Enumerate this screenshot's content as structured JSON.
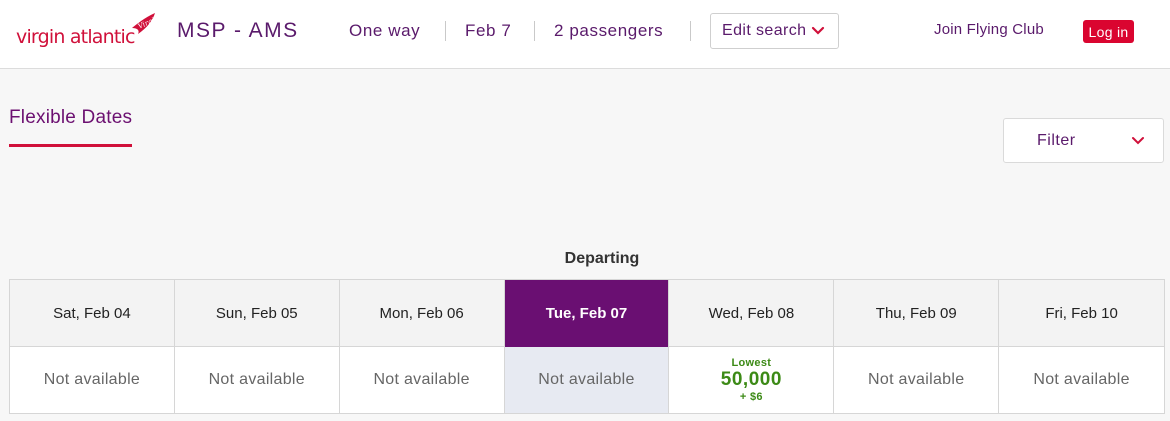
{
  "header": {
    "logo_text": "virgin atlantic",
    "logo_mark_text": "Virgin",
    "route": "MSP - AMS",
    "trip_type": "One way",
    "date": "Feb 7",
    "passengers": "2 passengers",
    "edit_search_label": "Edit search",
    "join_label": "Join Flying Club",
    "login_label": "Log in"
  },
  "colors": {
    "brand_purple": "#6a0f72",
    "brand_red": "#d0103a",
    "price_green": "#3c8a16"
  },
  "tabs": {
    "flexible_dates": "Flexible Dates"
  },
  "filter": {
    "label": "Filter"
  },
  "calendar": {
    "heading": "Departing",
    "days": [
      {
        "date": "Sat, Feb 04",
        "status": "Not available",
        "selected": false
      },
      {
        "date": "Sun, Feb 05",
        "status": "Not available",
        "selected": false
      },
      {
        "date": "Mon, Feb 06",
        "status": "Not available",
        "selected": false
      },
      {
        "date": "Tue, Feb 07",
        "status": "Not available",
        "selected": true
      },
      {
        "date": "Wed, Feb 08",
        "status": "",
        "selected": false,
        "label": "Lowest",
        "price": "50,000",
        "fee": "+ $6"
      },
      {
        "date": "Thu, Feb 09",
        "status": "Not available",
        "selected": false
      },
      {
        "date": "Fri, Feb 10",
        "status": "Not available",
        "selected": false
      }
    ]
  }
}
